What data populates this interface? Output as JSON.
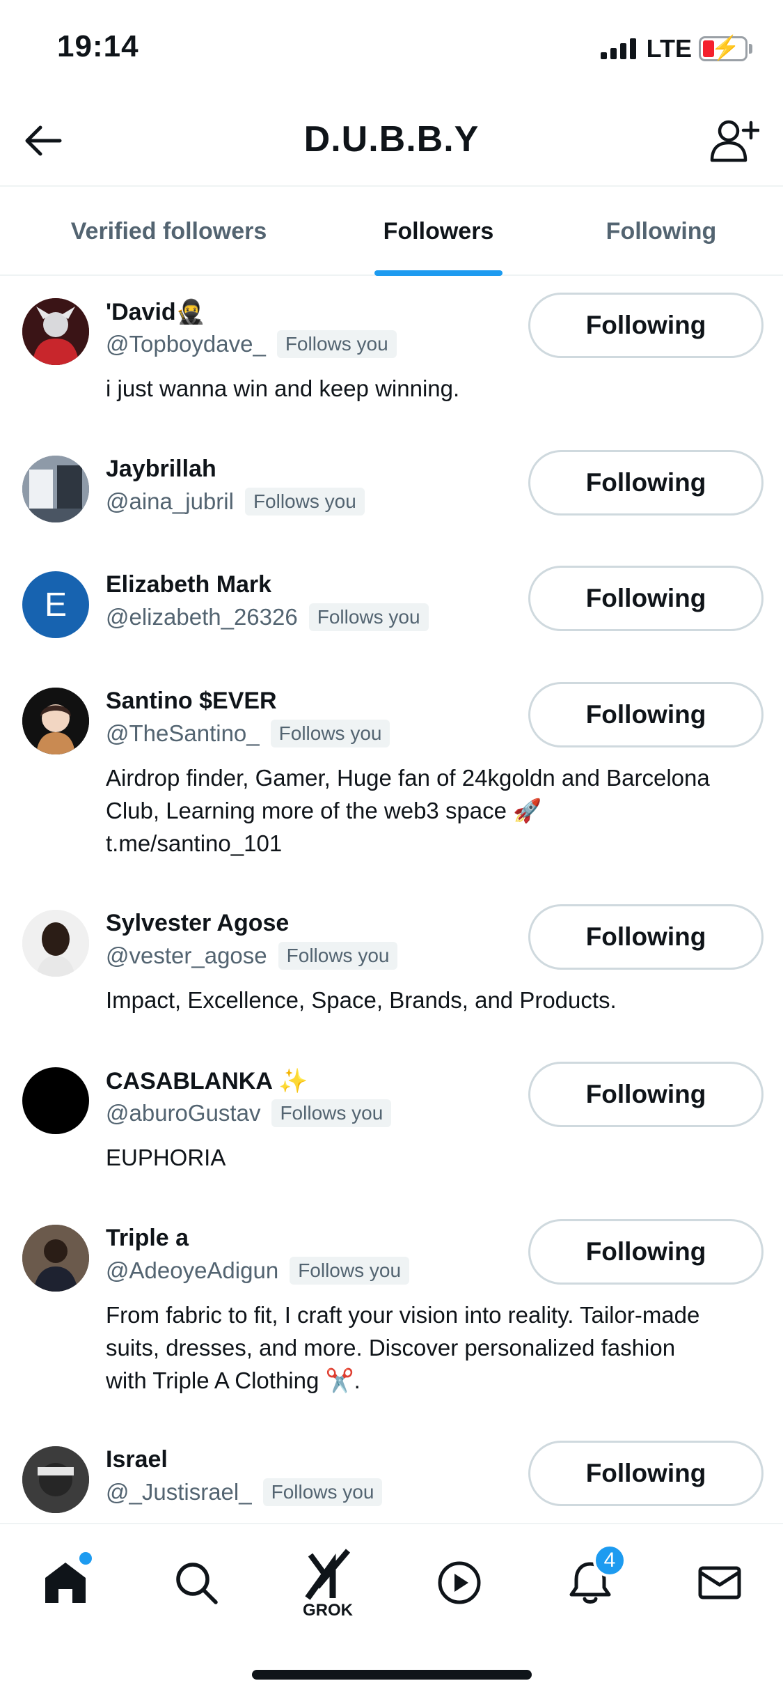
{
  "status_bar": {
    "time": "19:14",
    "network": "LTE"
  },
  "header": {
    "title": "D.U.B.B.Y"
  },
  "tabs": [
    {
      "label": "Verified followers"
    },
    {
      "label": "Followers"
    },
    {
      "label": "Following"
    }
  ],
  "active_tab": "Followers",
  "colors": {
    "accent": "#1d9bf0",
    "text": "#0f1419",
    "secondary": "#536471",
    "badge_bg": "#eff3f4",
    "battery_low": "#f4212e"
  },
  "follows_you_label": "Follows you",
  "follow_button_label": "Following",
  "users": [
    {
      "name": "'David🥷",
      "handle": "@Topboydave_",
      "bio": "i just wanna win and keep winning."
    },
    {
      "name": "Jaybrillah",
      "handle": "@aina_jubril",
      "bio": ""
    },
    {
      "name": "Elizabeth Mark",
      "handle": "@elizabeth_26326",
      "bio": "",
      "avatar_letter": "E"
    },
    {
      "name": "Santino $EVER",
      "handle": "@TheSantino_",
      "bio": "Airdrop finder, Gamer, Huge fan of 24kgoldn and Barcelona Club, Learning more of the web3 space 🚀 t.me/santino_101"
    },
    {
      "name": "Sylvester Agose",
      "handle": "@vester_agose",
      "bio": "Impact, Excellence, Space, Brands, and Products."
    },
    {
      "name": "CASABLANKA ✨",
      "handle": "@aburoGustav",
      "bio": "EUPHORIA"
    },
    {
      "name": "Triple a",
      "handle": "@AdeoyeAdigun",
      "bio": "From fabric to fit, I craft your vision into reality. Tailor-made suits, dresses, and more. Discover personalized fashion with Triple A Clothing ✂️."
    },
    {
      "name": "Israel",
      "handle": "@_Justisrael_",
      "bio": ""
    }
  ],
  "bottom_nav": {
    "items": [
      "home-icon",
      "search-icon",
      "grok-icon",
      "video-icon",
      "bell-icon",
      "mail-icon"
    ],
    "grok_label": "GROK",
    "notification_count": "4"
  }
}
